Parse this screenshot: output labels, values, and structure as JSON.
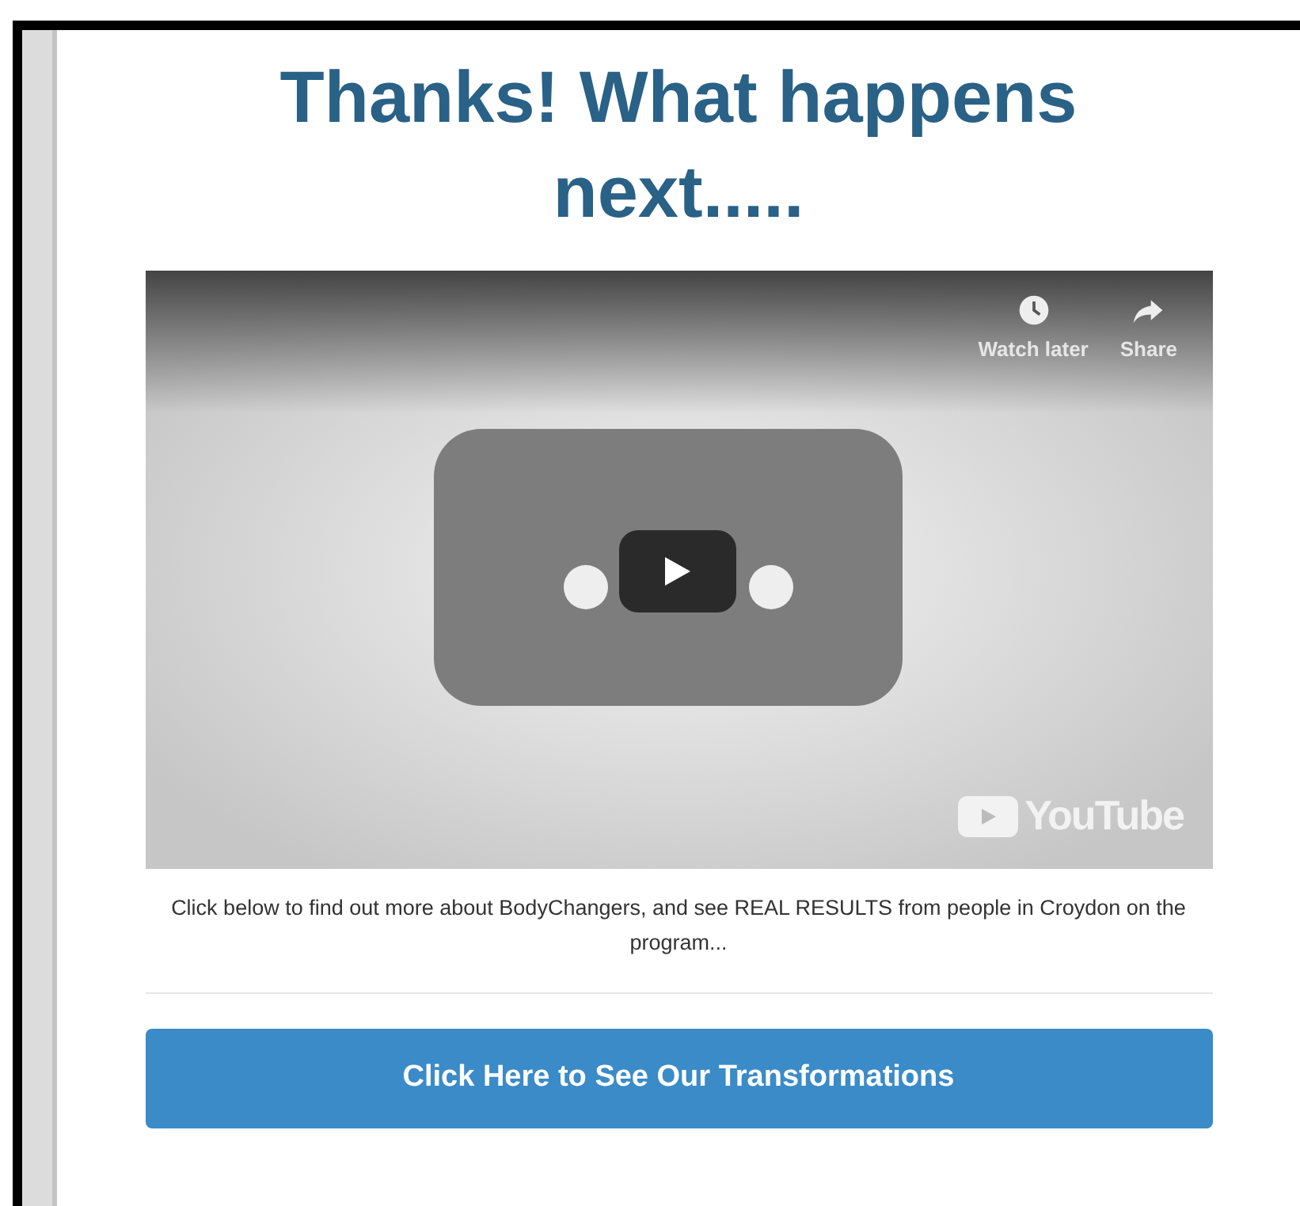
{
  "heading": "Thanks! What happens next.....",
  "video": {
    "actions": [
      "Watch later",
      "Share"
    ],
    "logo": "YouTube"
  },
  "caption": "Click below to find out more about BodyChangers, and see REAL RESULTS from people in Croydon on the program...",
  "button": "Click Here to See Our Transformations"
}
